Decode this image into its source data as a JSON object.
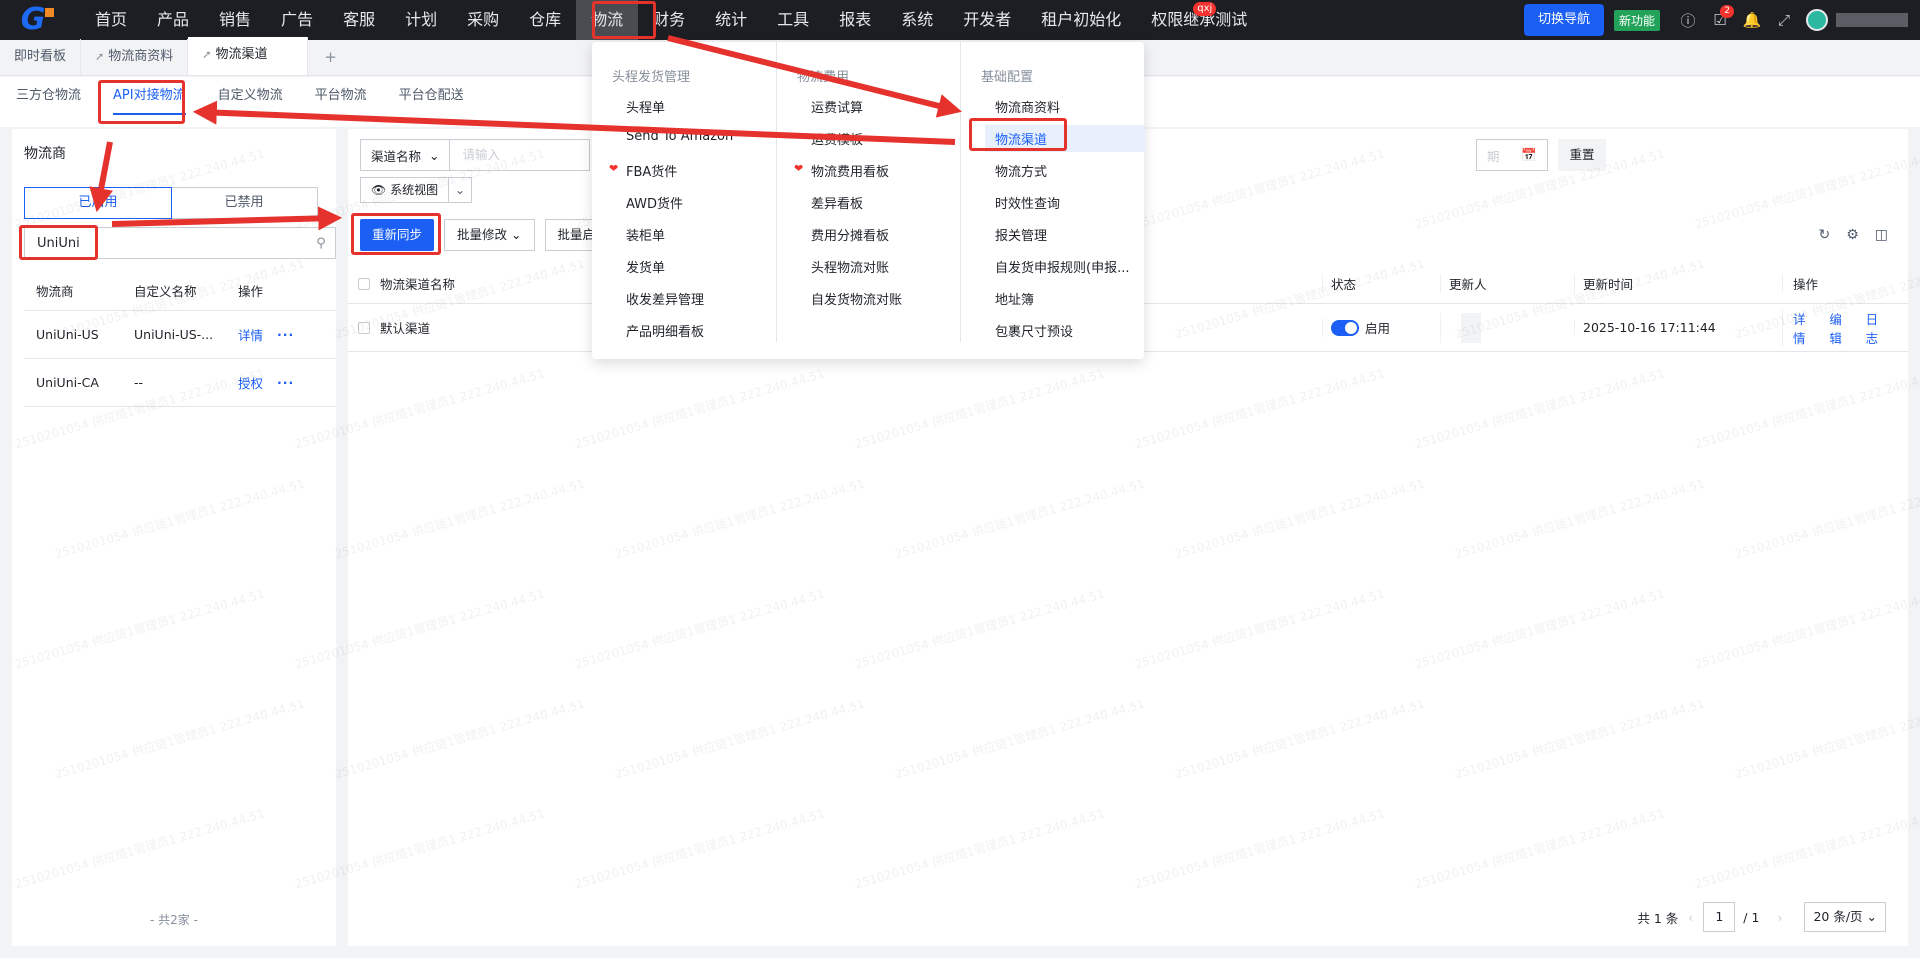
{
  "topnav": {
    "menu": [
      "首页",
      "产品",
      "销售",
      "广告",
      "客服",
      "计划",
      "采购",
      "仓库",
      "物流",
      "财务",
      "统计",
      "工具",
      "报表",
      "系统",
      "开发者",
      "租户初始化",
      "权限继承测试"
    ],
    "active_menu": "物流",
    "menu_badge": "qxj",
    "switch_nav": "切换导航",
    "new_feature": "新功能",
    "task_count": "2"
  },
  "page_tabs": {
    "items": [
      "即时看板",
      "物流商资料",
      "物流渠道"
    ],
    "active": "物流渠道"
  },
  "sub_tabs": {
    "items": [
      "三方仓物流",
      "API对接物流",
      "自定义物流",
      "平台物流",
      "平台仓配送"
    ],
    "active": "API对接物流"
  },
  "left_panel": {
    "title": "物流商",
    "segment": [
      "已启用",
      "已禁用"
    ],
    "search_value": "UniUni",
    "columns": [
      "物流商",
      "自定义名称",
      "操作"
    ],
    "rows": [
      {
        "carrier": "UniUni-US",
        "custom_name": "UniUni-US-...",
        "action": "详情"
      },
      {
        "carrier": "UniUni-CA",
        "custom_name": "--",
        "action": "授权"
      }
    ],
    "total": "- 共2家 -"
  },
  "right_panel": {
    "filter_select": "渠道名称",
    "filter_placeholder": "请输入",
    "date_tail": "期",
    "reset": "重置",
    "view": "系统视图",
    "buttons": [
      "重新同步",
      "批量修改",
      "批量启"
    ],
    "columns": {
      "name": "物流渠道名称",
      "status": "状态",
      "updater": "更新人",
      "time": "更新时间",
      "ops": "操作"
    },
    "rows": [
      {
        "name": "默认渠道",
        "status": "启用",
        "time": "2025-10-16 17:11:44",
        "ops": [
          "详情",
          "编辑",
          "日志"
        ]
      }
    ],
    "pager": {
      "total": "共 1 条",
      "page": "1",
      "of": "/ 1",
      "size": "20 条/页"
    }
  },
  "dropdown": {
    "col1": {
      "head": "头程发货管理",
      "items": [
        "头程单",
        "Send To Amazon",
        "FBA货件",
        "AWD货件",
        "装柜单",
        "发货单",
        "收发差异管理",
        "产品明细看板"
      ]
    },
    "col2": {
      "head": "物流费用",
      "items": [
        "运费试算",
        "运费模板",
        "物流费用看板",
        "差异看板",
        "费用分摊看板",
        "头程物流对账",
        "自发货物流对账"
      ]
    },
    "col3": {
      "head": "基础配置",
      "items": [
        "物流商资料",
        "物流渠道",
        "物流方式",
        "时效性查询",
        "报关管理",
        "自发货申报规则(申报...",
        "地址簿",
        "包裹尺寸预设"
      ]
    }
  },
  "watermark": "2510201054 供应链1管理员1 222.240.44.51",
  "colors": {
    "primary": "#1b5ff5",
    "annotation": "#e5322d",
    "nav_bg": "#1c1e23"
  }
}
